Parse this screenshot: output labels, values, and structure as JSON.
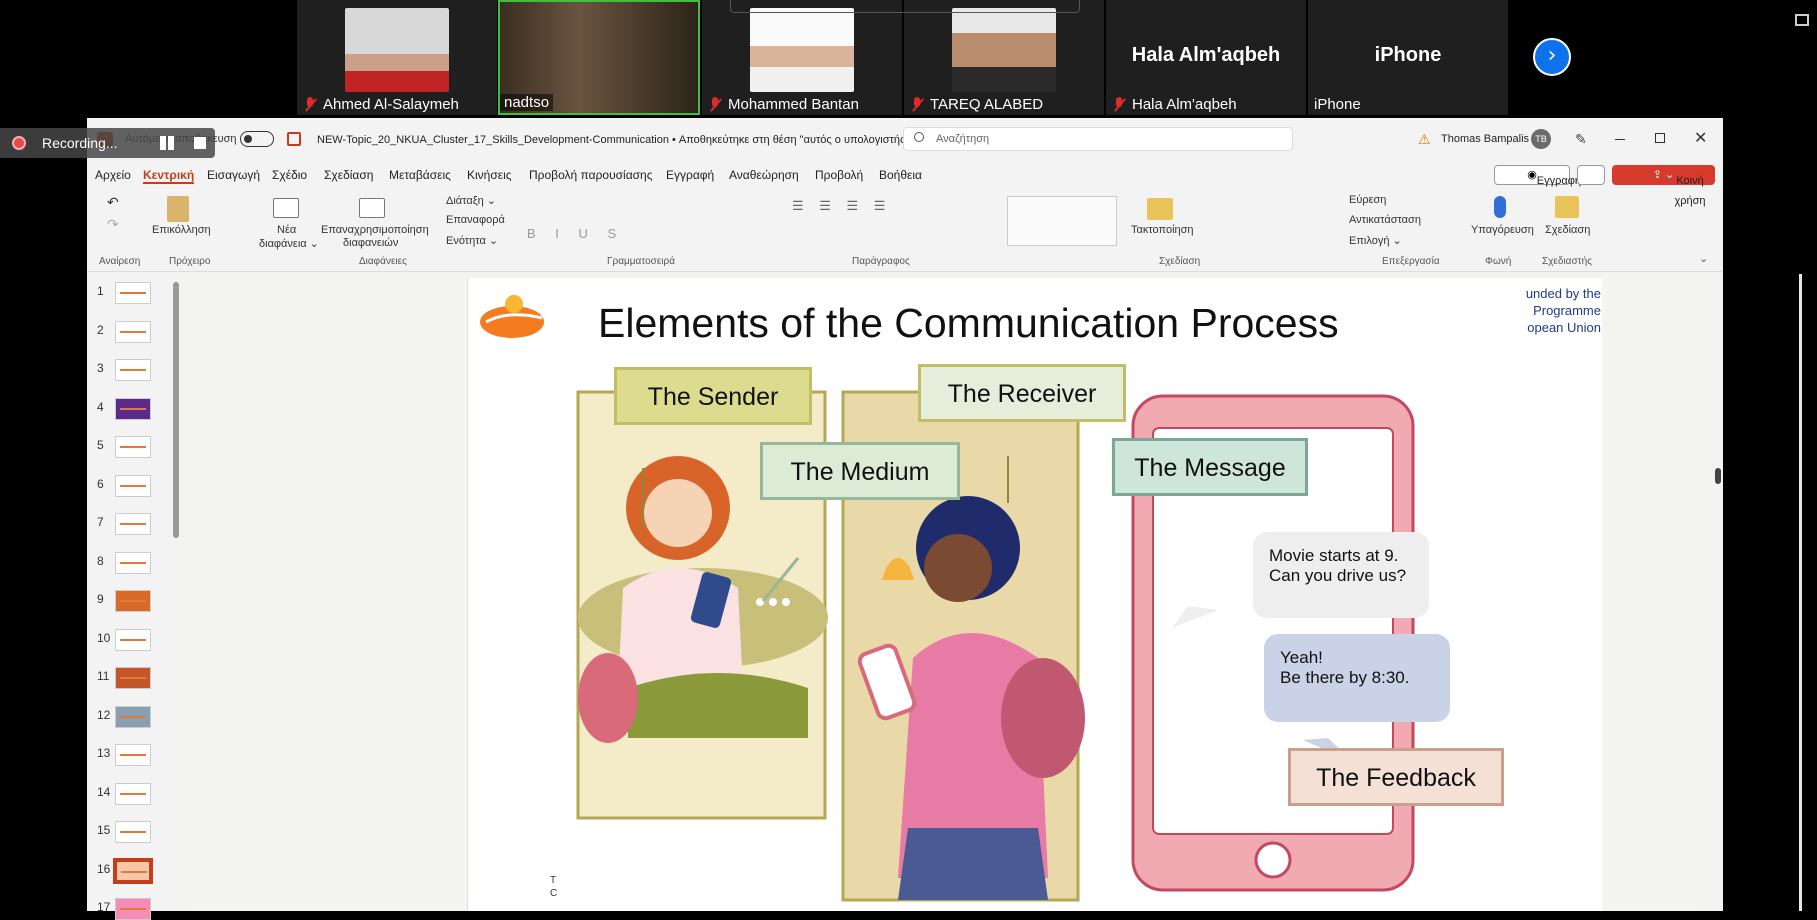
{
  "participants": [
    {
      "name": "Ahmed Al-Salaymeh",
      "muted": true,
      "video": true
    },
    {
      "name": "nadtso",
      "muted": false,
      "video": true
    },
    {
      "name": "Mohammed Bantan",
      "muted": true,
      "video": true
    },
    {
      "name": "TAREQ ALABED",
      "muted": true,
      "video": true
    },
    {
      "name": "Hala Alm'aqbeh",
      "muted": true,
      "video": false,
      "big": "Hala Alm'aqbeh"
    },
    {
      "name": "iPhone",
      "muted": false,
      "video": false,
      "big": "iPhone"
    }
  ],
  "recording": {
    "label": "Recording..."
  },
  "titlebar": {
    "autosave": "Αυτόματη αποθήκευση",
    "filename": "NEW-Topic_20_NKUA_Cluster_17_Skills_Development-Communication • Αποθηκεύτηκε στη θέση \"αυτός ο υπολογιστής\" ⌄",
    "search_placeholder": "Αναζήτηση",
    "user": "Thomas Bampalis",
    "initials": "TB"
  },
  "menu": [
    "Αρχείο",
    "Κεντρική",
    "Εισαγωγή",
    "Σχέδιο",
    "Σχεδίαση",
    "Μεταβάσεις",
    "Κινήσεις",
    "Προβολή παρουσίασης",
    "Εγγραφή",
    "Αναθεώρηση",
    "Προβολή",
    "Βοήθεια"
  ],
  "actions": {
    "record": "Εγγραφή",
    "share": "Κοινή χρήση"
  },
  "ribbon": {
    "paste": "Επικόλληση",
    "new_slide": [
      "Νέα",
      "διαφάνεια ⌄"
    ],
    "reuse": [
      "Επαναχρησιμοποίηση",
      "διαφανειών"
    ],
    "layout": "Διάταξη ⌄",
    "reset": "Επαναφορά",
    "section": "Ενότητα ⌄",
    "arrange": "Τακτοποίηση",
    "find": "Εύρεση",
    "replace": "Αντικατάσταση",
    "select": "Επιλογή ⌄",
    "dictate": "Υπαγόρευση",
    "designer": "Σχεδίαση",
    "groups": [
      "Αναίρεση",
      "Πρόχειρο",
      "Διαφάνειες",
      "Γραμματοσειρά",
      "Παράγραφος",
      "Σχεδίαση",
      "Επεξεργασία",
      "Φωνή",
      "Σχεδιαστής"
    ]
  },
  "slides": [
    "1",
    "2",
    "3",
    "4",
    "5",
    "6",
    "7",
    "8",
    "9",
    "10",
    "11",
    "12",
    "13",
    "14",
    "15",
    "16",
    "17"
  ],
  "current_slide": "16",
  "slide": {
    "title": "Elements of the Communication Process",
    "funding": [
      "unded by the",
      "Programme",
      "opean Union"
    ],
    "sender": "The Sender",
    "receiver": "The Receiver",
    "medium": "The Medium",
    "message": "The Message",
    "feedback": "The Feedback",
    "msg1": [
      "Movie starts at 9.",
      "Can you drive us?"
    ],
    "msg2": [
      "Yeah!",
      "Be there by 8:30."
    ],
    "footer": [
      "T",
      "C"
    ]
  },
  "colors": {
    "accent": "#c43e1c",
    "share": "#d63a2c",
    "zoom_blue": "#0e72ed"
  }
}
